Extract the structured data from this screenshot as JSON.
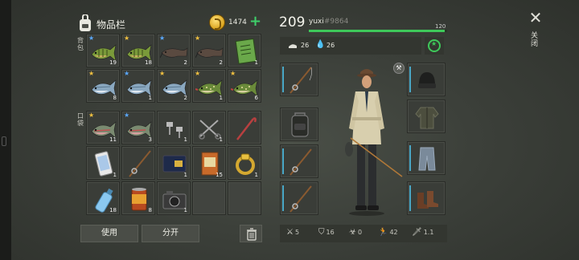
{
  "inventory": {
    "title": "物品栏",
    "coins": "1474",
    "plus_label": "+",
    "backpack_label": "背包",
    "pocket_label": "口袋",
    "use_button": "使用",
    "split_button": "分开"
  },
  "slots_backpack": [
    {
      "item": "perch-fish",
      "count": "19",
      "star": "blue"
    },
    {
      "item": "perch-fish",
      "count": "18",
      "star": "gold"
    },
    {
      "item": "catfish",
      "count": "2",
      "star": "blue"
    },
    {
      "item": "catfish",
      "count": "2",
      "star": "gold"
    },
    {
      "item": "notebook",
      "count": "1",
      "star": ""
    },
    {
      "item": "herring-fish",
      "count": "8",
      "star": "gold"
    },
    {
      "item": "herring-fish",
      "count": "1",
      "star": "blue"
    },
    {
      "item": "herring-fish",
      "count": "2",
      "star": "gold"
    },
    {
      "item": "pike-fish",
      "count": "1",
      "star": "gold"
    },
    {
      "item": "pike-fish",
      "count": "6",
      "star": "gold"
    }
  ],
  "slots_pocket": [
    {
      "item": "trout-fish",
      "count": "11",
      "star": "gold"
    },
    {
      "item": "trout-fish",
      "count": "3",
      "star": "blue"
    },
    {
      "item": "bolts",
      "count": "1",
      "star": ""
    },
    {
      "item": "scissors",
      "count": "1",
      "star": ""
    },
    {
      "item": "crowbar",
      "count": "",
      "star": ""
    },
    {
      "item": "phone",
      "count": "1",
      "star": ""
    },
    {
      "item": "fishing-rod",
      "count": "",
      "star": ""
    },
    {
      "item": "wallet",
      "count": "1",
      "star": ""
    },
    {
      "item": "seed-bag",
      "count": "15",
      "star": ""
    },
    {
      "item": "gold-ring",
      "count": "1",
      "star": ""
    },
    {
      "item": "water-bottle",
      "count": "18",
      "star": ""
    },
    {
      "item": "canned-food",
      "count": "8",
      "star": ""
    },
    {
      "item": "camera",
      "count": "1",
      "star": ""
    },
    {
      "item": "",
      "count": "",
      "star": ""
    },
    {
      "item": "",
      "count": "",
      "star": ""
    }
  ],
  "character": {
    "level": "209",
    "username": "yuxi",
    "user_id": "#9864",
    "xp_max": "120",
    "xp_fraction": 0.98,
    "food": "26",
    "water": "26"
  },
  "bottom_stats": {
    "attack": "5",
    "defense": "16",
    "toxicity": "0",
    "speed": "42",
    "damage": "1.1"
  },
  "close_label": "关闭",
  "close_glyph": "✕",
  "colors": {
    "accent_green": "#3ec85a",
    "accent_blue": "#4aa8c8",
    "gold_star": "#f0c040",
    "blue_star": "#5aa8ff"
  }
}
